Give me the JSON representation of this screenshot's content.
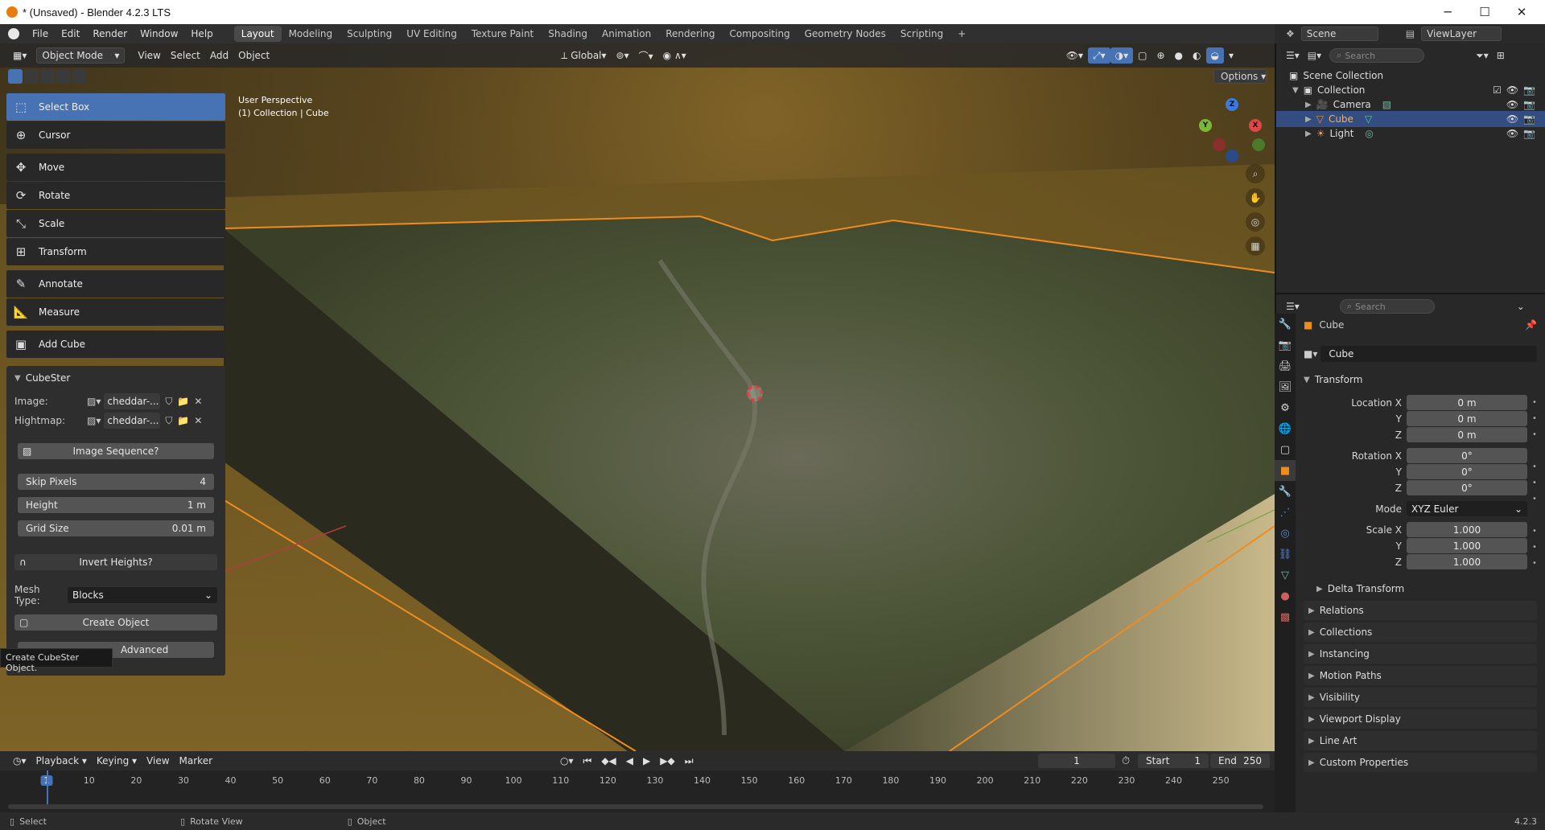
{
  "window": {
    "title": "* (Unsaved) - Blender 4.2.3 LTS",
    "minimize": "─",
    "maximize": "☐",
    "close": "✕"
  },
  "menu": [
    "File",
    "Edit",
    "Render",
    "Window",
    "Help"
  ],
  "workspaces": [
    "Layout",
    "Modeling",
    "Sculpting",
    "UV Editing",
    "Texture Paint",
    "Shading",
    "Animation",
    "Rendering",
    "Compositing",
    "Geometry Nodes",
    "Scripting"
  ],
  "scene": {
    "name": "Scene",
    "view_layer": "ViewLayer"
  },
  "viewport": {
    "mode": "Object Mode",
    "menus": [
      "View",
      "Select",
      "Add",
      "Object"
    ],
    "orientation": "Global",
    "options_label": "Options",
    "overlay_title": "User Perspective",
    "overlay_subtitle": "(1) Collection | Cube",
    "gizmo": {
      "x": "X",
      "y": "Y",
      "z": "Z"
    }
  },
  "tools": [
    "Select Box",
    "Cursor",
    "Move",
    "Rotate",
    "Scale",
    "Transform",
    "Annotate",
    "Measure",
    "Add Cube"
  ],
  "cubester": {
    "title": "CubeSter",
    "image_label": "Image:",
    "image_value": "cheddar-...",
    "hightmap_label": "Hightmap:",
    "hightmap_value": "cheddar-...",
    "image_sequence": "Image Sequence?",
    "skip_pixels_label": "Skip Pixels",
    "skip_pixels_value": "4",
    "height_label": "Height",
    "height_value": "1 m",
    "grid_size_label": "Grid Size",
    "grid_size_value": "0.01 m",
    "invert_heights": "Invert Heights?",
    "mesh_type_label": "Mesh Type:",
    "mesh_type_value": "Blocks",
    "create_object": "Create Object",
    "advanced": "Advanced",
    "tooltip": "Create CubeSter Object."
  },
  "timeline": {
    "menus": [
      "Playback",
      "Keying",
      "View",
      "Marker"
    ],
    "current_frame": "1",
    "start_label": "Start",
    "start_value": "1",
    "end_label": "End",
    "end_value": "250",
    "ticks": [
      "1",
      "10",
      "20",
      "30",
      "40",
      "50",
      "60",
      "70",
      "80",
      "90",
      "100",
      "110",
      "120",
      "130",
      "140",
      "150",
      "160",
      "170",
      "180",
      "190",
      "200",
      "210",
      "220",
      "230",
      "240",
      "250"
    ]
  },
  "status": {
    "select": "Select",
    "rotate": "Rotate View",
    "object": "Object",
    "version": "4.2.3"
  },
  "outliner": {
    "search_placeholder": "Search",
    "scene_collection": "Scene Collection",
    "collection": "Collection",
    "items": [
      "Camera",
      "Cube",
      "Light"
    ]
  },
  "properties": {
    "search_placeholder": "Search",
    "object_name": "Cube",
    "object_field": "Cube",
    "transform": "Transform",
    "location_label": "Location X",
    "location": [
      "0 m",
      "0 m",
      "0 m"
    ],
    "rotation_label": "Rotation X",
    "rotation": [
      "0°",
      "0°",
      "0°"
    ],
    "mode_label": "Mode",
    "mode_value": "XYZ Euler",
    "scale_label": "Scale X",
    "scale": [
      "1.000",
      "1.000",
      "1.000"
    ],
    "axis_y": "Y",
    "axis_z": "Z",
    "delta_transform": "Delta Transform",
    "sections": [
      "Relations",
      "Collections",
      "Instancing",
      "Motion Paths",
      "Visibility",
      "Viewport Display",
      "Line Art",
      "Custom Properties"
    ]
  },
  "colors": {
    "accent": "#4772b3",
    "orange": "#f08c1e",
    "selected_row": "#334d80"
  }
}
